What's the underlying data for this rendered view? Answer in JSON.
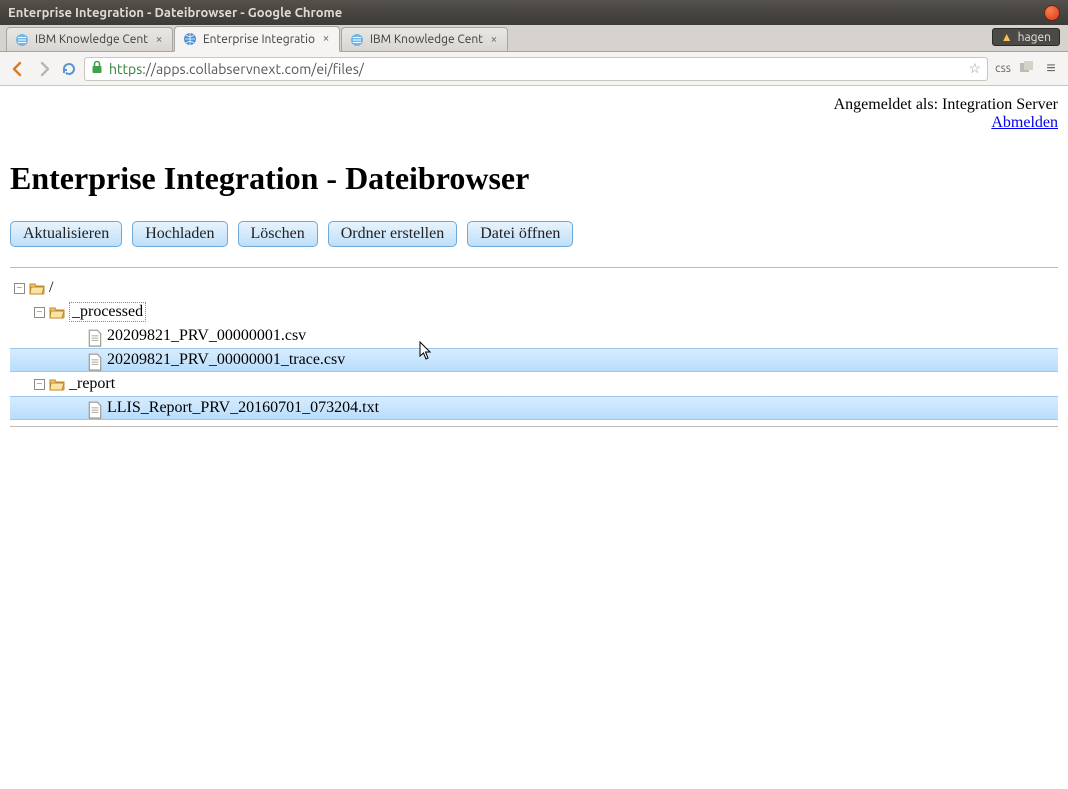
{
  "window": {
    "title": "Enterprise Integration - Dateibrowser - Google Chrome"
  },
  "tabs": [
    {
      "label": "IBM Knowledge Cent",
      "favicon": "ibm"
    },
    {
      "label": "Enterprise Integratio",
      "favicon": "globe",
      "active": true
    },
    {
      "label": "IBM Knowledge Cent",
      "favicon": "ibm"
    }
  ],
  "user_badge": {
    "name": "hagen"
  },
  "address": {
    "scheme": "https",
    "host_path": "://apps.collabservnext.com/ei/files/",
    "css_label": "css"
  },
  "page": {
    "logged_in_prefix": "Angemeldet als: ",
    "logged_in_user": "Integration Server",
    "logout": "Abmelden",
    "heading": "Enterprise Integration - Dateibrowser",
    "buttons": {
      "refresh": "Aktualisieren",
      "upload": "Hochladen",
      "delete": "Löschen",
      "mkdir": "Ordner erstellen",
      "open": "Datei öffnen"
    },
    "tree": {
      "root": "/",
      "folders": [
        {
          "name": "_processed",
          "selected": true,
          "files": [
            {
              "name": "20209821_PRV_00000001.csv",
              "selected": false
            },
            {
              "name": "20209821_PRV_00000001_trace.csv",
              "selected": true
            }
          ]
        },
        {
          "name": "_report",
          "selected": false,
          "files": [
            {
              "name": "LLIS_Report_PRV_20160701_073204.txt",
              "selected": true
            }
          ]
        }
      ]
    }
  }
}
